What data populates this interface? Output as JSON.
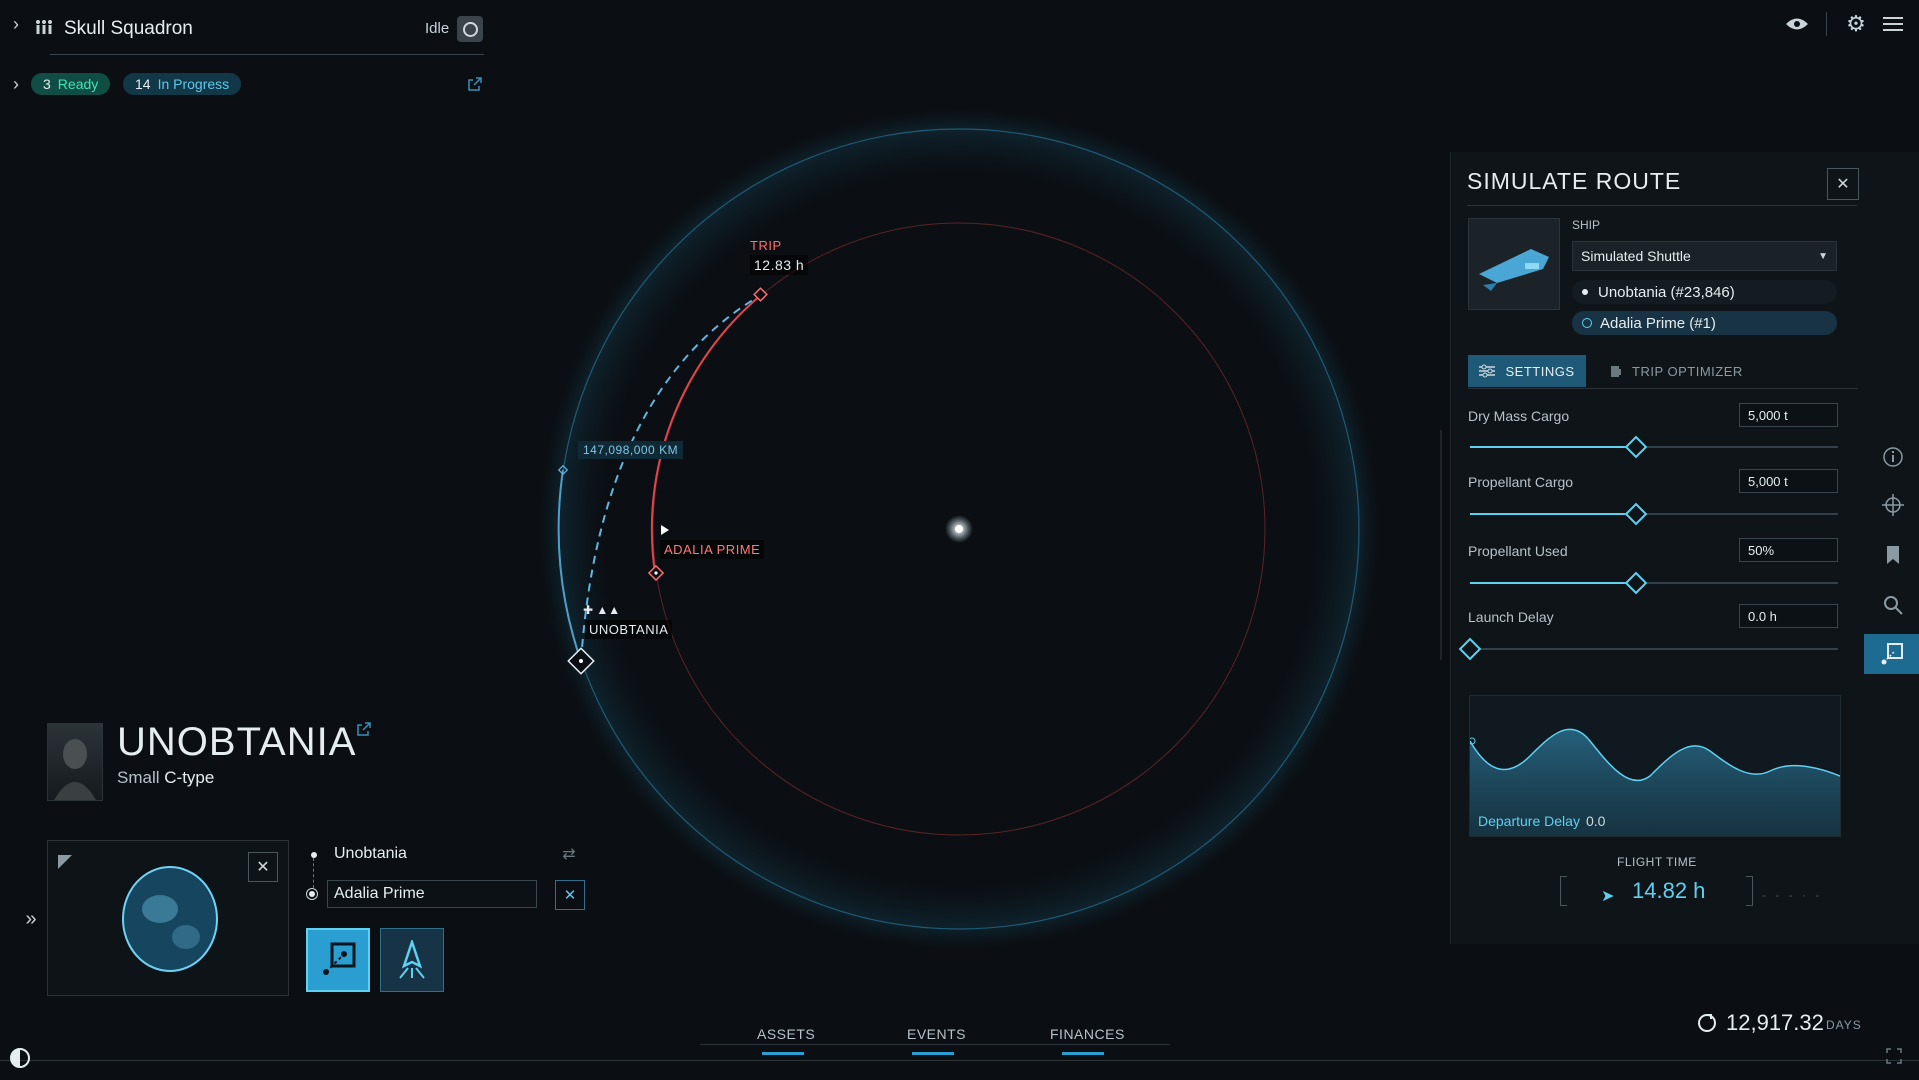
{
  "crew": {
    "name": "Skull Squadron",
    "status": "Idle",
    "ready_count": "3",
    "ready_label": "Ready",
    "progress_count": "14",
    "progress_label": "In Progress"
  },
  "map": {
    "trip_label": "TRIP",
    "trip_time": "12.83 h",
    "distance": "147,098,000 KM",
    "destination_label": "ADALIA PRIME",
    "origin_label": "UNOBTANIA"
  },
  "asteroid": {
    "name": "UNOBTANIA",
    "size": "Small",
    "type": "C-type"
  },
  "route": {
    "from": "Unobtania",
    "to": "Adalia Prime"
  },
  "bottom_tabs": [
    "ASSETS",
    "EVENTS",
    "FINANCES"
  ],
  "time": {
    "days": "12,917.32",
    "unit": "DAYS"
  },
  "simulate": {
    "title": "SIMULATE ROUTE",
    "ship_label": "SHIP",
    "ship_selected": "Simulated Shuttle",
    "origin": "Unobtania (#23,846)",
    "destination": "Adalia Prime (#1)",
    "tab_settings": "SETTINGS",
    "tab_optimizer": "TRIP OPTIMIZER",
    "settings": [
      {
        "label": "Dry Mass Cargo",
        "value": "5,000 t",
        "level": 0.45
      },
      {
        "label": "Propellant Cargo",
        "value": "5,000 t",
        "level": 0.45
      },
      {
        "label": "Propellant Used",
        "value": "50%",
        "level": 0.45
      },
      {
        "label": "Launch Delay",
        "value": "0.0 h",
        "level": 0.0
      }
    ],
    "departure_label": "Departure Delay",
    "departure_value": "0.0",
    "flight_label": "FLIGHT TIME",
    "flight_value": "14.82 h"
  },
  "colors": {
    "accent": "#5fd0f0",
    "danger": "#ff6b6b",
    "ready": "#3ee6b4",
    "panel": "#0f1418"
  }
}
